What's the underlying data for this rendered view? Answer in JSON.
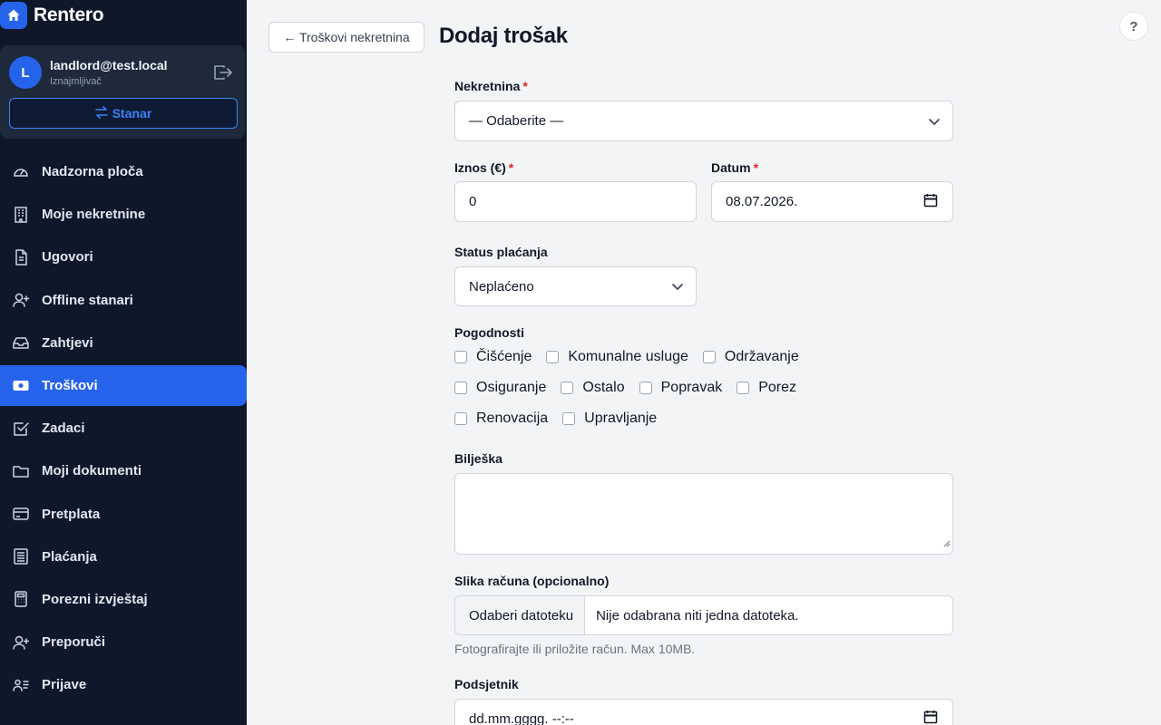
{
  "brand": {
    "name": "Rentero"
  },
  "user": {
    "initial": "L",
    "email": "landlord@test.local",
    "role": "Iznajmljivač",
    "switch_label": "Stanar"
  },
  "nav": [
    {
      "label": "Nadzorna ploča",
      "icon": "gauge-icon"
    },
    {
      "label": "Moje nekretnine",
      "icon": "building-icon"
    },
    {
      "label": "Ugovori",
      "icon": "document-icon"
    },
    {
      "label": "Offline stanari",
      "icon": "user-plus-icon"
    },
    {
      "label": "Zahtjevi",
      "icon": "inbox-icon"
    },
    {
      "label": "Troškovi",
      "icon": "cash-icon",
      "active": true
    },
    {
      "label": "Zadaci",
      "icon": "checkbox-icon"
    },
    {
      "label": "Moji dokumenti",
      "icon": "folder-icon"
    },
    {
      "label": "Pretplata",
      "icon": "credit-card-icon"
    },
    {
      "label": "Plaćanja",
      "icon": "ledger-icon"
    },
    {
      "label": "Porezni izvještaj",
      "icon": "calculator-icon"
    },
    {
      "label": "Preporuči",
      "icon": "user-plus-icon"
    },
    {
      "label": "Prijave",
      "icon": "id-card-icon"
    }
  ],
  "header": {
    "back_label": "← Troškovi nekretnina",
    "title": "Dodaj trošak",
    "help": "?"
  },
  "form": {
    "property": {
      "label": "Nekretnina",
      "required": "*",
      "value": "— Odaberite —"
    },
    "amount": {
      "label": "Iznos (€)",
      "required": "*",
      "value": "0"
    },
    "date": {
      "label": "Datum",
      "required": "*",
      "value": "08.07.2026."
    },
    "status": {
      "label": "Status plaćanja",
      "value": "Neplaćeno"
    },
    "categories": {
      "label": "Pogodnosti",
      "row1": [
        "Čišćenje",
        "Komunalne usluge",
        "Održavanje"
      ],
      "row2": [
        "Osiguranje",
        "Ostalo",
        "Popravak",
        "Porez"
      ],
      "row3": [
        "Renovacija",
        "Upravljanje"
      ]
    },
    "note": {
      "label": "Bilješka",
      "value": ""
    },
    "receipt": {
      "label": "Slika računa (opcionalno)",
      "button": "Odaberi datoteku",
      "file_text": "Nije odabrana niti jedna datoteka.",
      "hint": "Fotografirajte ili priložite račun. Max 10MB."
    },
    "reminder": {
      "label": "Podsjetnik",
      "value": "dd.mm.gggg. --:--"
    }
  },
  "colors": {
    "sidebar": "#0f172a",
    "accent": "#2563eb",
    "required": "#dc2626"
  }
}
